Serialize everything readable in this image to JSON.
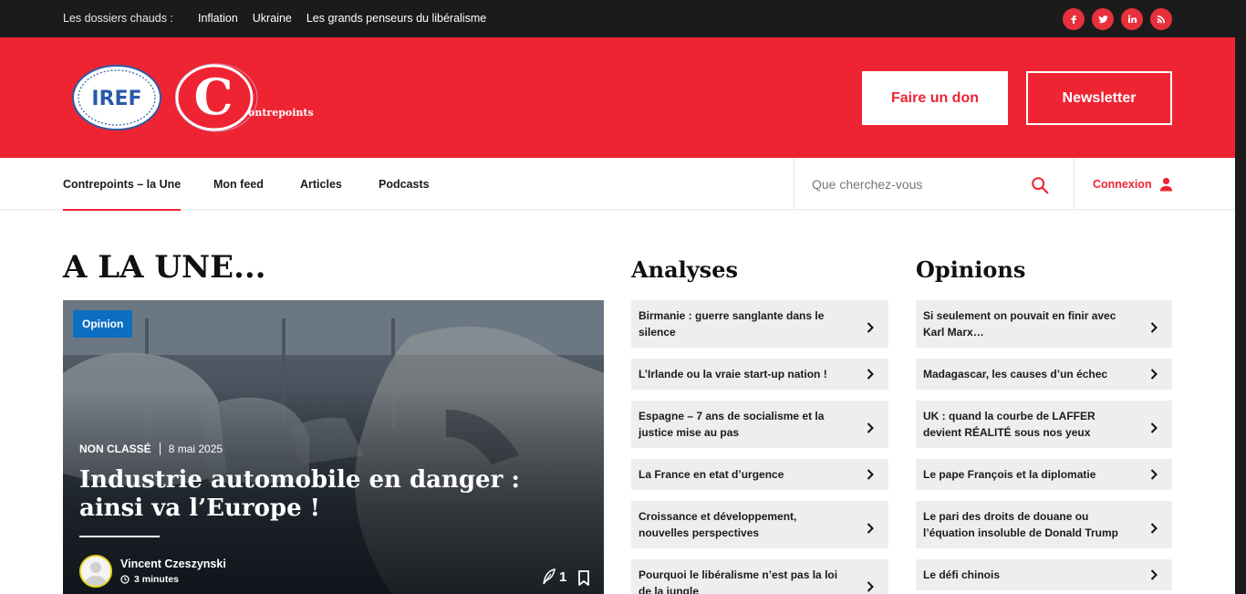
{
  "topbar": {
    "hot_label": "Les dossiers chauds :",
    "hot_links": [
      "Inflation",
      "Ukraine",
      "Les grands penseurs du libéralisme"
    ],
    "socials": [
      "facebook-icon",
      "twitter-icon",
      "linkedin-icon",
      "rss-icon"
    ]
  },
  "header": {
    "logo_iref": "IREF",
    "logo_cp_letter": "C",
    "logo_cp_word": "ontrepoints",
    "donate_label": "Faire un don",
    "newsletter_label": "Newsletter",
    "brand_color": "#ee2433"
  },
  "nav": {
    "items": [
      "Contrepoints – la Une",
      "Mon feed",
      "Articles",
      "Podcasts"
    ],
    "active_index": 0,
    "search_placeholder": "Que cherchez-vous",
    "login_label": "Connexion"
  },
  "main": {
    "une_title": "A LA UNE...",
    "hero": {
      "badge": "Opinion",
      "category": "NON CLASSÉ",
      "date": "8 mai 2025",
      "title": "Industrie automobile en danger : ainsi va l’Europe !",
      "author": "Vincent Czeszynski",
      "read_time": "3 minutes",
      "comment_count": "1"
    },
    "analyses": {
      "title": "Analyses",
      "items": [
        "Birmanie : guerre sanglante dans le silence",
        "L’Irlande ou la vraie start-up nation !",
        "Espagne – 7 ans de socialisme et la justice mise au pas",
        "La France en etat d’urgence",
        "Croissance et développement, nouvelles perspectives",
        "Pourquoi le libéralisme n’est pas la loi de la jungle"
      ]
    },
    "opinions": {
      "title": "Opinions",
      "items": [
        "Si seulement on pouvait en finir avec Karl Marx…",
        "Madagascar, les causes d’un échec",
        "UK : quand la courbe de LAFFER devient RÉALITÉ sous nos yeux",
        "Le pape François et la diplomatie",
        "Le pari des droits de douane ou l’équation insoluble de Donald Trump",
        "Le défi chinois"
      ]
    }
  }
}
